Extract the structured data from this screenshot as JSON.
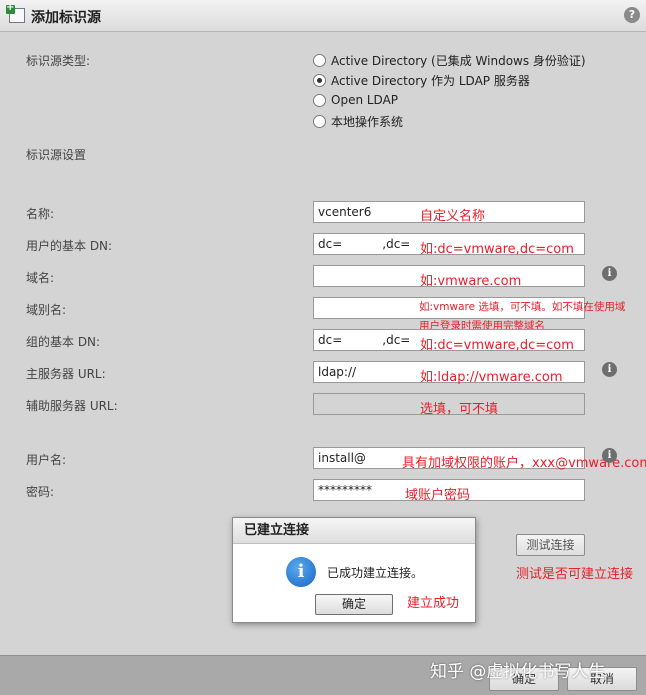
{
  "window": {
    "title": "添加标识源",
    "help": "?"
  },
  "source_type": {
    "label": "标识源类型:",
    "options": [
      {
        "label": "Active Directory (已集成 Windows 身份验证)",
        "checked": false
      },
      {
        "label": "Active Directory 作为 LDAP 服务器",
        "checked": true
      },
      {
        "label": "Open LDAP",
        "checked": false
      },
      {
        "label": "本地操作系统",
        "checked": false
      }
    ]
  },
  "settings_label": "标识源设置",
  "fields": {
    "name": {
      "label": "名称:",
      "value": "vcenter6"
    },
    "base_dn_users": {
      "label": "用户的基本 DN:",
      "value_prefix": "dc=",
      "value_mid": ",dc="
    },
    "domain": {
      "label": "域名:"
    },
    "alias": {
      "label": "域别名:"
    },
    "base_dn_groups": {
      "label": "组的基本 DN:",
      "value_prefix": "dc=",
      "value_mid": ",dc="
    },
    "primary_url": {
      "label": "主服务器 URL:",
      "value_prefix": "ldap://"
    },
    "secondary_url": {
      "label": "辅助服务器 URL:"
    },
    "username": {
      "label": "用户名:",
      "value_prefix": "install@"
    },
    "password": {
      "label": "密码:",
      "value": "*********"
    }
  },
  "annotations": {
    "name": "自定义名称",
    "base_dn_users": "如:dc=vmware,dc=com",
    "domain": "如:vmware.com",
    "alias_line1": "如:vmware 选填，可不填。如不填在使用域",
    "alias_line2": "用户登录时需使用完整域名",
    "base_dn_groups": "如:dc=vmware,dc=com",
    "primary_url": "如:ldap://vmware.com",
    "secondary_url": "选填，可不填",
    "username": "具有加域权限的账户，xxx@vmware.com",
    "password": "域账户密码",
    "test": "测试是否可建立连接",
    "dialog": "建立成功"
  },
  "test_button": "测试连接",
  "dialog": {
    "title": "已建立连接",
    "message": "已成功建立连接。",
    "ok": "确定"
  },
  "footer": {
    "ok": "确定",
    "cancel": "取消"
  },
  "watermark": "知乎 @虚拟化书写人生",
  "icons": {
    "info": "i",
    "dialog_info": "i"
  }
}
